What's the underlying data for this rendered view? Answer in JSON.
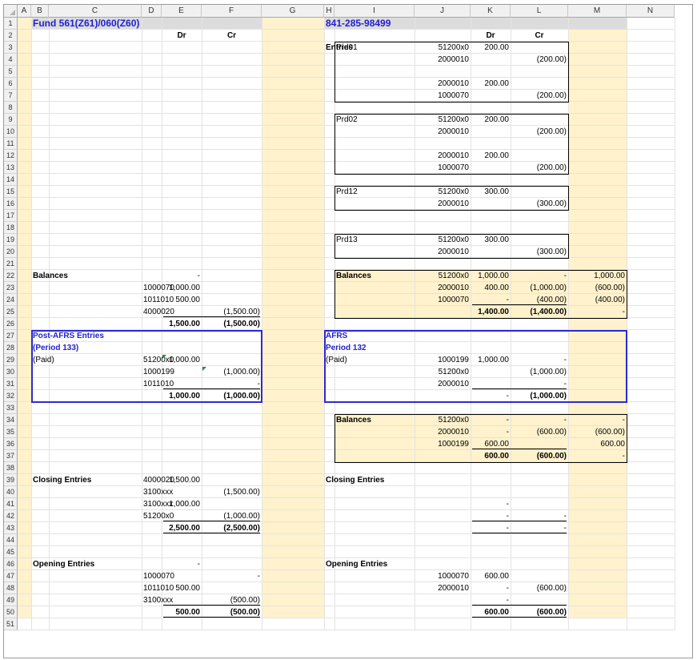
{
  "columns": [
    "A",
    "B",
    "C",
    "D",
    "E",
    "F",
    "G",
    "H",
    "I",
    "J",
    "K",
    "L",
    "M",
    "N"
  ],
  "row_count": 51,
  "colors": {
    "panel_fill": "#fff2cc",
    "title_blue": "#1f1fd1",
    "box_blue": "#2b2bd6",
    "header_gray": "#f0f0f0",
    "comment_marker": "#1f8b3a"
  },
  "left": {
    "title": "Fund 561(Z61)/060(Z60)",
    "dr": "Dr",
    "cr": "Cr",
    "balances": {
      "label": "Balances",
      "top": "-",
      "rows": [
        {
          "acct": "1000070",
          "dr": "1,000.00",
          "cr": ""
        },
        {
          "acct": "1011010",
          "dr": "500.00",
          "cr": ""
        },
        {
          "acct": "4000020",
          "dr": "",
          "cr": "(1,500.00)"
        }
      ],
      "total_dr": "1,500.00",
      "total_cr": "(1,500.00)"
    },
    "post_afrs": {
      "title": "Post-AFRS Entries",
      "subtitle": "(Period 133)",
      "note": "(Paid)",
      "rows": [
        {
          "acct": "51200x0",
          "dr": "1,000.00",
          "cr": ""
        },
        {
          "acct": "1000199",
          "dr": "",
          "cr": "(1,000.00)"
        },
        {
          "acct": "1011010",
          "dr": "",
          "cr": "-"
        }
      ],
      "total_dr": "1,000.00",
      "total_cr": "(1,000.00)"
    },
    "closing": {
      "label": "Closing Entries",
      "rows": [
        {
          "acct": "4000020",
          "dr": "1,500.00",
          "cr": ""
        },
        {
          "acct": "3100xxx",
          "dr": "",
          "cr": "(1,500.00)"
        },
        {
          "acct": "3100xxx",
          "dr": "1,000.00",
          "cr": ""
        },
        {
          "acct": "51200x0",
          "dr": "",
          "cr": "(1,000.00)"
        }
      ],
      "total_dr": "2,500.00",
      "total_cr": "(2,500.00)"
    },
    "opening": {
      "label": "Opening Entries",
      "top": "-",
      "rows": [
        {
          "acct": "1000070",
          "dr": "",
          "cr": "-"
        },
        {
          "acct": "1011010",
          "dr": "500.00",
          "cr": ""
        },
        {
          "acct": "3100xxx",
          "dr": "",
          "cr": "(500.00)"
        }
      ],
      "total_dr": "500.00",
      "total_cr": "(500.00)"
    }
  },
  "right": {
    "title": "841-285-98499",
    "dr": "Dr",
    "cr": "Cr",
    "entries_label": "Entries",
    "periods": [
      {
        "name": "Prd01",
        "lines": [
          {
            "acct": "51200x0",
            "dr": "200.00",
            "cr": ""
          },
          {
            "acct": "2000010",
            "dr": "",
            "cr": "(200.00)"
          },
          {
            "acct": "",
            "dr": "",
            "cr": ""
          },
          {
            "acct": "2000010",
            "dr": "200.00",
            "cr": ""
          },
          {
            "acct": "1000070",
            "dr": "",
            "cr": "(200.00)"
          }
        ]
      },
      {
        "name": "Prd02",
        "lines": [
          {
            "acct": "51200x0",
            "dr": "200.00",
            "cr": ""
          },
          {
            "acct": "2000010",
            "dr": "",
            "cr": "(200.00)"
          },
          {
            "acct": "",
            "dr": "",
            "cr": ""
          },
          {
            "acct": "2000010",
            "dr": "200.00",
            "cr": ""
          },
          {
            "acct": "1000070",
            "dr": "",
            "cr": "(200.00)"
          }
        ]
      },
      {
        "name": "Prd12",
        "lines": [
          {
            "acct": "51200x0",
            "dr": "300.00",
            "cr": ""
          },
          {
            "acct": "2000010",
            "dr": "",
            "cr": "(300.00)"
          }
        ]
      },
      {
        "name": "Prd13",
        "lines": [
          {
            "acct": "51200x0",
            "dr": "300.00",
            "cr": ""
          },
          {
            "acct": "2000010",
            "dr": "",
            "cr": "(300.00)"
          }
        ]
      }
    ],
    "balances1": {
      "label": "Balances",
      "rows": [
        {
          "acct": "51200x0",
          "dr": "1,000.00",
          "cr": "-",
          "net": "1,000.00"
        },
        {
          "acct": "2000010",
          "dr": "400.00",
          "cr": "(1,000.00)",
          "net": "(600.00)"
        },
        {
          "acct": "1000070",
          "dr": "-",
          "cr": "(400.00)",
          "net": "(400.00)"
        }
      ],
      "total_dr": "1,400.00",
      "total_cr": "(1,400.00)",
      "total_net": "-"
    },
    "afrs": {
      "title": "AFRS",
      "subtitle": "Period 132",
      "note": "(Paid)",
      "rows": [
        {
          "acct": "1000199",
          "dr": "1,000.00",
          "cr": "-"
        },
        {
          "acct": "51200x0",
          "dr": "",
          "cr": "(1,000.00)"
        },
        {
          "acct": "2000010",
          "dr": "",
          "cr": "-"
        }
      ],
      "total_dr": "-",
      "total_cr": "(1,000.00)"
    },
    "balances2": {
      "label": "Balances",
      "rows": [
        {
          "acct": "51200x0",
          "dr": "-",
          "cr": "-",
          "net": "-"
        },
        {
          "acct": "2000010",
          "dr": "-",
          "cr": "(600.00)",
          "net": "(600.00)"
        },
        {
          "acct": "1000199",
          "dr": "600.00",
          "cr": "",
          "net": "600.00"
        }
      ],
      "total_dr": "600.00",
      "total_cr": "(600.00)",
      "total_net": "-"
    },
    "closing": {
      "label": "Closing Entries",
      "rows": [
        {
          "dr": "",
          "cr": ""
        },
        {
          "dr": "-",
          "cr": ""
        },
        {
          "dr": "-",
          "cr": "-"
        }
      ],
      "total_dr": "-",
      "total_cr": "-"
    },
    "opening": {
      "label": "Opening Entries",
      "rows": [
        {
          "acct": "1000070",
          "dr": "600.00",
          "cr": ""
        },
        {
          "acct": "2000010",
          "dr": "-",
          "cr": "(600.00)"
        },
        {
          "acct": "",
          "dr": "-",
          "cr": ""
        }
      ],
      "total_dr": "600.00",
      "total_cr": "(600.00)"
    }
  }
}
